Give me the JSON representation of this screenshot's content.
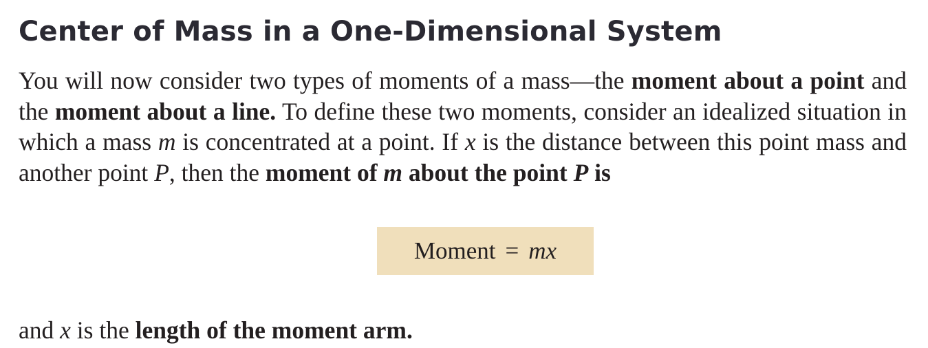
{
  "heading": "Center of Mass in a One-Dimensional System",
  "intro": {
    "t1": "You will now consider two types of moments of a mass—the ",
    "b1": "moment about a point",
    "t2": " and the ",
    "b2": "moment about a line.",
    "t3": " To define these two moments, consider an idealized situation in which a mass ",
    "i1": "m",
    "t4": " is concentrated at a point. If ",
    "i2": "x",
    "t5": " is the distance between this point mass and another point ",
    "i3": "P",
    "t6": ", then the ",
    "b3": "moment of ",
    "bi1": "m",
    "b4": " about the point ",
    "bi2": "P",
    "b5": " is"
  },
  "formula": {
    "label": "Moment",
    "equals": "=",
    "expression": "mx",
    "box_color": "#f0dfbb"
  },
  "closing": {
    "t1": "and ",
    "i1": "x",
    "t2": " is the ",
    "b1": "length of the moment arm."
  }
}
